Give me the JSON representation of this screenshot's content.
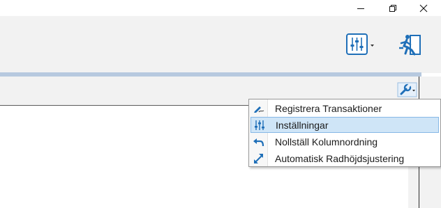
{
  "window": {
    "controls": [
      "minimize",
      "maximize",
      "close"
    ]
  },
  "toolbar": {
    "settings_icon": "sliders-icon",
    "exit_icon": "exit-icon",
    "accent": "#1f6fb8"
  },
  "grid": {
    "options_icon": "wrench-icon"
  },
  "menu": {
    "items": [
      {
        "label": "Registrera Transaktioner",
        "icon": "pencil-icon",
        "selected": false
      },
      {
        "label": "Inställningar",
        "icon": "sliders-icon",
        "selected": true
      },
      {
        "label": "Nollställ Kolumnordning",
        "icon": "undo-arrow-icon",
        "selected": false
      },
      {
        "label": "Automatisk Radhöjdsjustering",
        "icon": "resize-arrows-icon",
        "selected": false
      }
    ]
  }
}
